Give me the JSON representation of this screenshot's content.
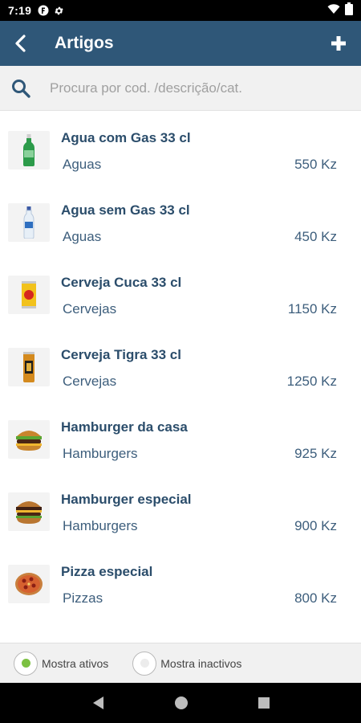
{
  "status": {
    "time": "7:19"
  },
  "header": {
    "title": "Artigos"
  },
  "search": {
    "placeholder": "Procura por cod. /descrição/cat."
  },
  "items": [
    {
      "name": "Agua com Gas 33 cl",
      "category": "Aguas",
      "price": "550 Kz",
      "icon": "green-bottle-image"
    },
    {
      "name": "Agua sem Gas 33 cl",
      "category": "Aguas",
      "price": "450 Kz",
      "icon": "water-bottle-image"
    },
    {
      "name": "Cerveja Cuca 33 cl",
      "category": "Cervejas",
      "price": "1150 Kz",
      "icon": "beer-can-image"
    },
    {
      "name": "Cerveja Tigra 33 cl",
      "category": "Cervejas",
      "price": "1250 Kz",
      "icon": "beer-can-image"
    },
    {
      "name": "Hamburger da casa",
      "category": "Hamburgers",
      "price": "925 Kz",
      "icon": "burger-image"
    },
    {
      "name": "Hamburger especial",
      "category": "Hamburgers",
      "price": "900 Kz",
      "icon": "burger-image"
    },
    {
      "name": "Pizza especial",
      "category": "Pizzas",
      "price": "800 Kz",
      "icon": "pizza-image"
    }
  ],
  "filters": {
    "active_label": "Mostra ativos",
    "inactive_label": "Mostra inactivos",
    "selected": "active"
  },
  "colors": {
    "app_bar": "#2f5778",
    "item_title": "#2b4d6b",
    "radio_selected": "#7cc142"
  }
}
